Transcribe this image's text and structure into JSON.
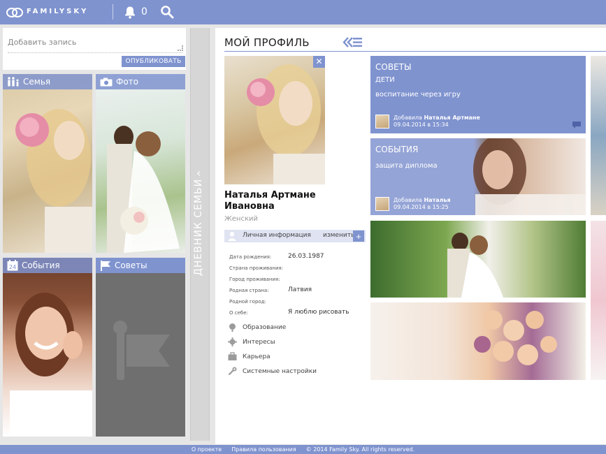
{
  "header": {
    "logo_text": "FAMILYSKY",
    "notifications_count": "0"
  },
  "post": {
    "placeholder": "Добавить запись",
    "publish_label": "ОПУБЛИКОВАТЬ"
  },
  "tiles": {
    "family": "Семья",
    "photo": "Фото",
    "events": "События",
    "events_day": "24",
    "advice": "Советы"
  },
  "diary": {
    "label": "ДНЕВНИК СЕМЬИ"
  },
  "profile": {
    "title": "МОЙ ПРОФИЛЬ",
    "name_first": "Наталья Артмане",
    "name_last": "Ивановна",
    "gender": "Женский",
    "info_label": "Личная информация",
    "edit_label": "изменить",
    "rows": [
      {
        "key": "Дата рождения:",
        "value": "26.03.1987"
      },
      {
        "key": "Страна проживания:",
        "value": ""
      },
      {
        "key": "Город проживания:",
        "value": ""
      },
      {
        "key": "Родная страна:",
        "value": "Латвия"
      },
      {
        "key": "Родной город:",
        "value": ""
      },
      {
        "key": "О себе:",
        "value": "Я люблю рисовать"
      }
    ],
    "sections": [
      "Образование",
      "Интересы",
      "Карьера",
      "Системные настройки"
    ]
  },
  "cards": {
    "advice": {
      "title": "СОВЕТЫ",
      "subtitle": "ДЕТИ",
      "description": "воспитание через игру",
      "author_prefix": "Добавила",
      "author": "Наталья Артмане",
      "date": "09.04.2014 в 15:34"
    },
    "events": {
      "title": "СОБЫТИЯ",
      "description": "защита диплома",
      "author_prefix": "Добавила",
      "author": "Наталья",
      "date": "09.04.2014 в 15:25"
    }
  },
  "footer": {
    "about": "О проекте",
    "terms": "Правила пользования",
    "copyright": "© 2014 Family Sky. All rights reserved."
  },
  "colors": {
    "brand": "#7f93cf",
    "brand_light": "#dfe3f2"
  }
}
